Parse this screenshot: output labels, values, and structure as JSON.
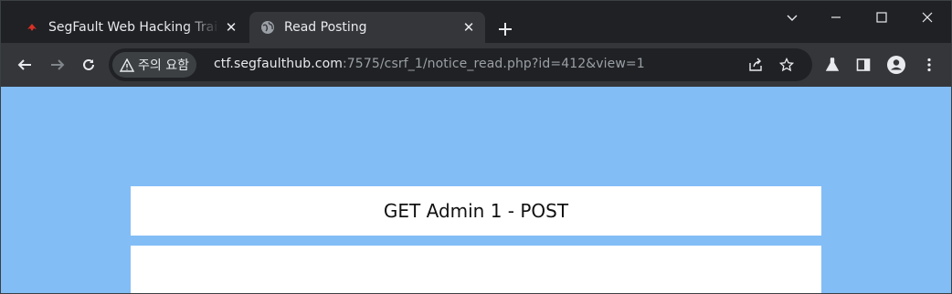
{
  "browser": {
    "tabs": [
      {
        "title": "SegFault Web Hacking Trai",
        "favicon": "segfault-logo-icon",
        "active": false
      },
      {
        "title": "Read Posting",
        "favicon": "globe-icon",
        "active": true
      }
    ],
    "address_bar": {
      "security_label": "주의 요함",
      "url_host": "ctf.segfaulthub.com",
      "url_rest": ":7575/csrf_1/notice_read.php?id=412&view=1"
    }
  },
  "page": {
    "title": "GET Admin 1 - POST",
    "background_color": "#82bdf6"
  }
}
